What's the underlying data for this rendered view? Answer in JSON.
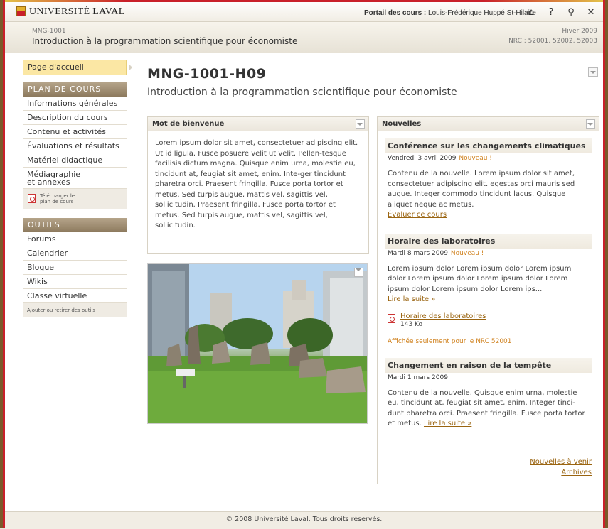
{
  "topbar": {
    "logo": "UNIVERSITÉ LAVAL",
    "portal_label": "Portail des cours :",
    "portal_user": "Louis-Frédérique Huppé St-Hilaire",
    "icons": [
      "home-icon",
      "help-icon",
      "search-icon",
      "close-icon"
    ]
  },
  "header": {
    "course_code": "MNG-1001",
    "course_title": "Introduction à la programmation scientifique pour économiste",
    "semester": "Hiver 2009",
    "nrc": "NRC : 52001, 52002, 52003"
  },
  "sidebar": {
    "home": "Page d'accueil",
    "plan_title": "PLAN DE COURS",
    "plan_items": [
      "Informations générales",
      "Description du cours",
      "Contenu et activités",
      "Évaluations et résultats",
      "Matériel didactique",
      "Médiagraphie et annexes"
    ],
    "plan_items_media_l1": "Médiagraphie",
    "plan_items_media_l2": "et annexes",
    "download_l1": "Télécharger le",
    "download_l2": "plan de cours",
    "tools_title": "OUTILS",
    "tools_items": [
      "Forums",
      "Calendrier",
      "Blogue",
      "Wikis",
      "Classe virtuelle"
    ],
    "tools_edit": "Ajouter ou retirer des outils"
  },
  "main": {
    "title": "MNG-1001-H09",
    "subtitle": "Introduction à la programmation scientifique pour économiste"
  },
  "welcome": {
    "title": "Mot de bienvenue",
    "body": "Lorem ipsum dolor sit amet, consectetuer adipiscing elit. Ut id ligula. Fusce posuere velit ut velit. Pellen-tesque facilisis dictum magna. Quisque enim urna, molestie eu, tincidunt at, feugiat sit amet, enim. Inte-ger tincidunt pharetra orci. Praesent fringilla. Fusce porta tortor et metus. Sed turpis augue, mattis vel, sagittis vel, sollicitudin. Praesent fringilla. Fusce porta tortor et metus. Sed turpis augue, mattis vel, sagittis vel, sollicitudin."
  },
  "news": {
    "title": "Nouvelles",
    "items": [
      {
        "heading": "Conférence sur les changements climatiques",
        "date": "Vendredi 3 avril 2009",
        "badge": "Nouveau !",
        "body": "Contenu de la nouvelle. Lorem ipsum dolor sit amet, consectetuer adipiscing elit. egestas orci mauris sed augue. Integer commodo tincidunt lacus. Quisque aliquet neque ac metus.",
        "link": "Évaluer ce cours"
      },
      {
        "heading": "Horaire des laboratoires",
        "date": "Mardi 8 mars 2009",
        "badge": "Nouveau !",
        "body": "Lorem ipsum dolor Lorem ipsum dolor Lorem ipsum dolor Lorem ipsum dolor Lorem ipsum dolor Lorem ipsum dolor Lorem ipsum dolor Lorem ips...",
        "link": "Lire la suite »",
        "attachment_name": "Horaire des laboratoires",
        "attachment_size": "143 Ko",
        "note": "Affichée seulement pour le NRC 52001"
      },
      {
        "heading": "Changement en raison de la tempête",
        "date": "Mardi 1 mars 2009",
        "body": "Contenu de la nouvelle. Quisque enim urna, molestie eu, tincidunt at, feugiat sit amet, enim. Integer tinci-dunt pharetra orci. Praesent fringilla. Fusce porta tortor et metus.",
        "link": "Lire la suite »"
      }
    ],
    "upcoming": "Nouvelles à venir",
    "archives": "Archives"
  },
  "footer": {
    "text": "© 2008 Université Laval. Tous droits réservés."
  }
}
